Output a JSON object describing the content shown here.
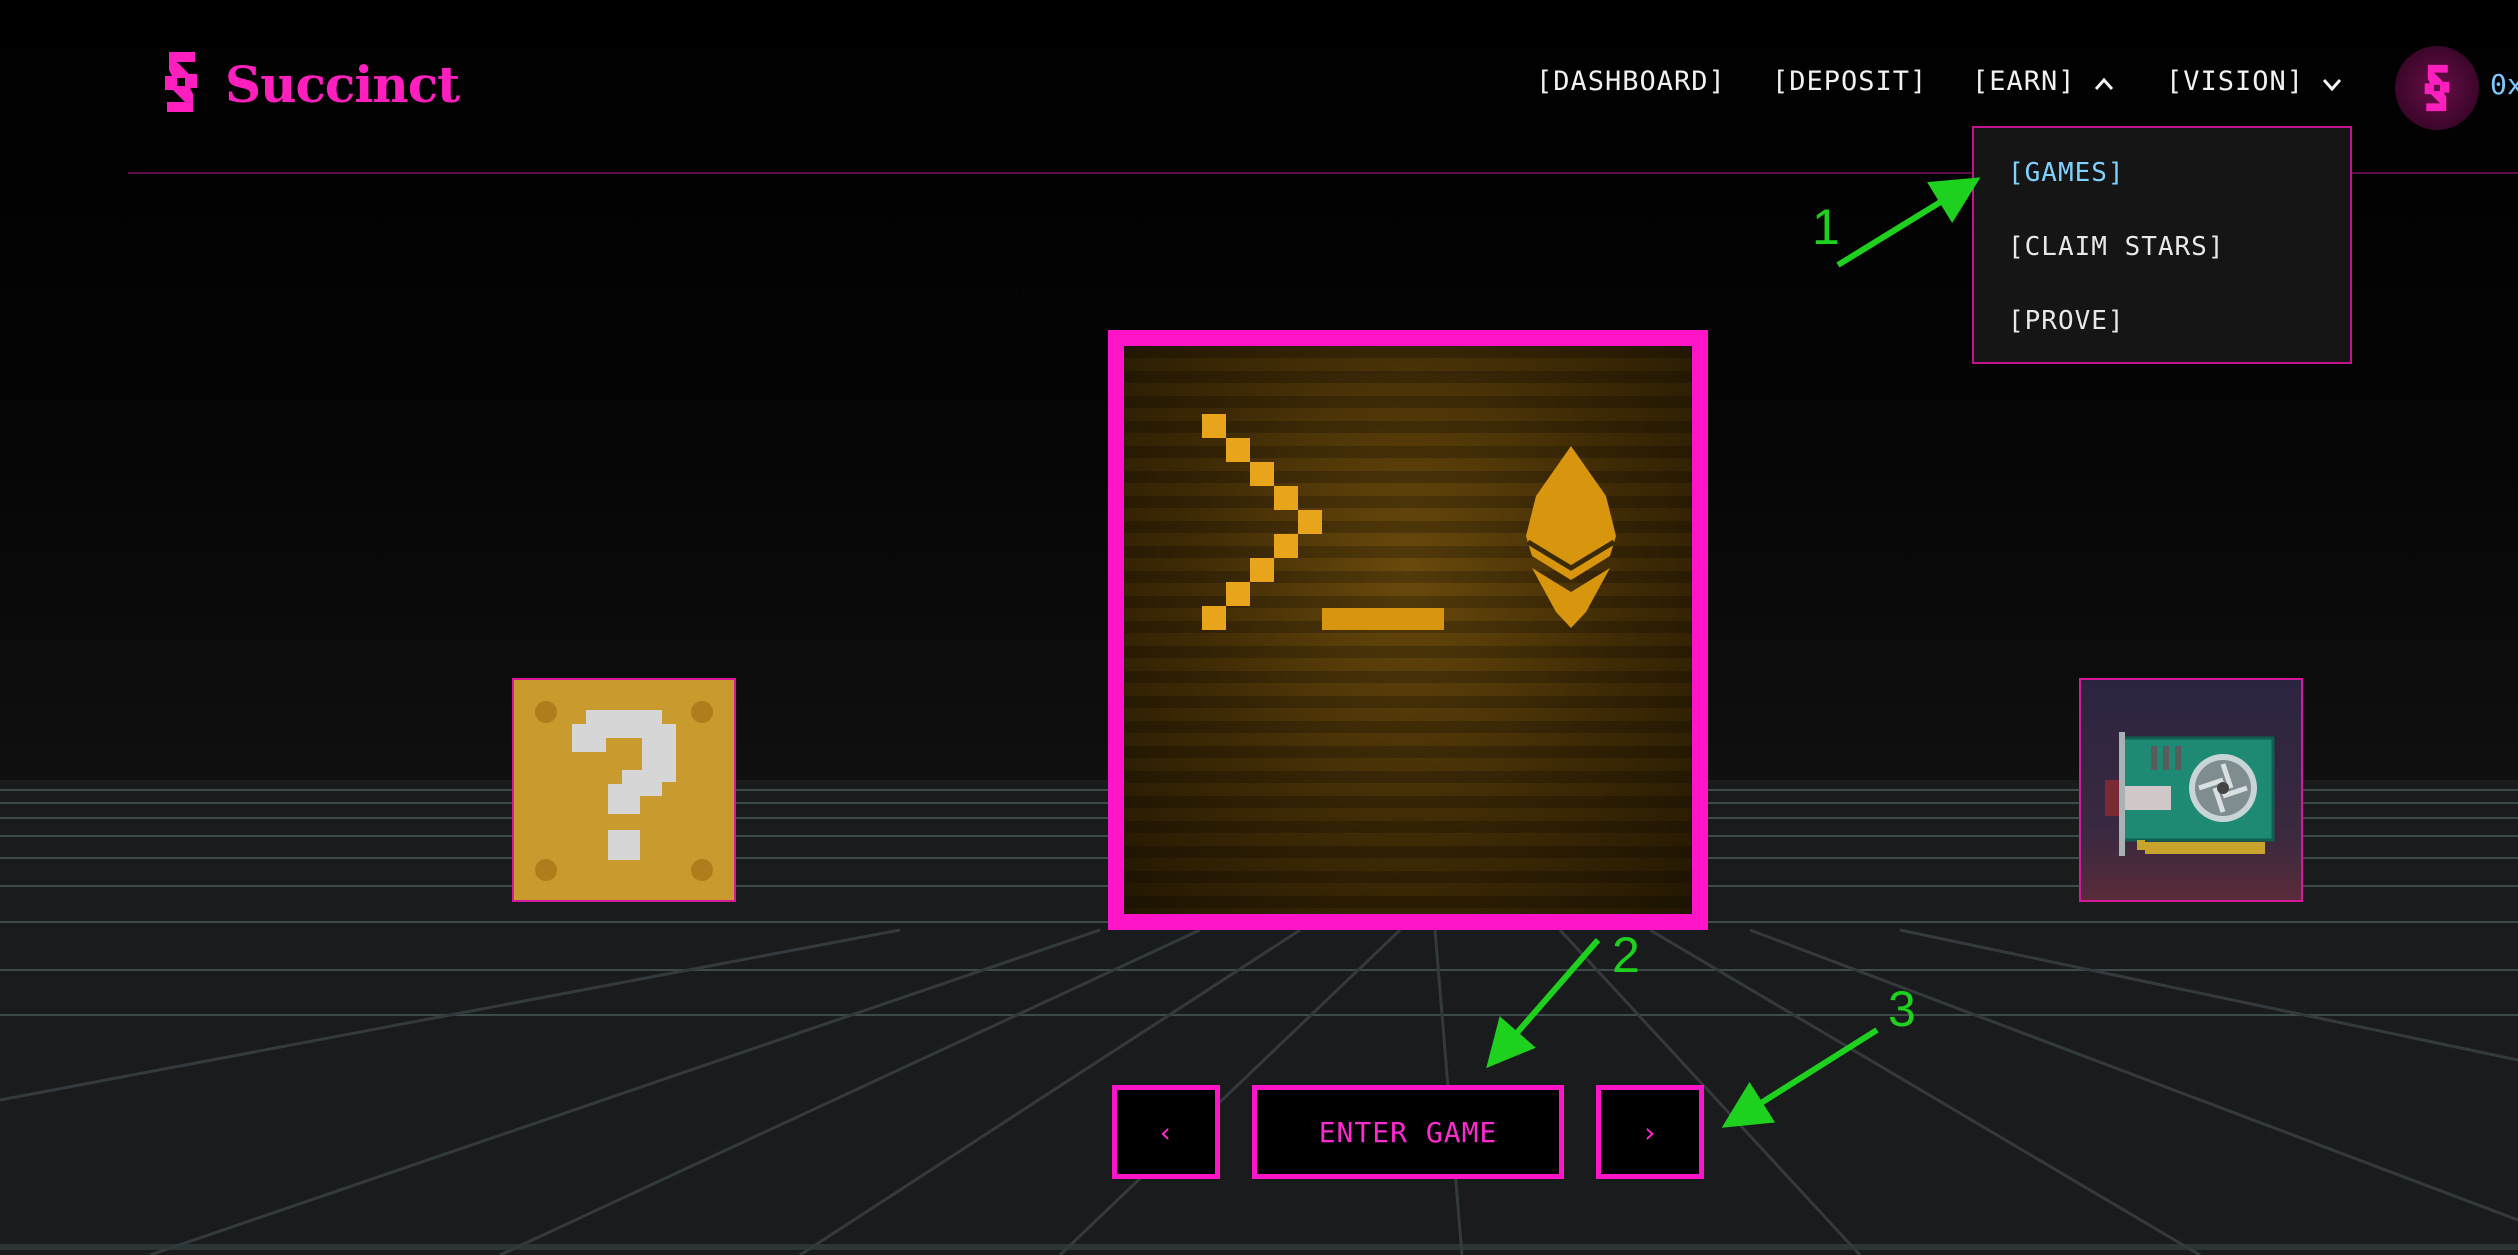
{
  "brand": {
    "name": "Succinct",
    "color": "#ff1fbf"
  },
  "nav": {
    "items": [
      {
        "label": "[DASHBOARD]"
      },
      {
        "label": "[DEPOSIT]"
      },
      {
        "label": "[EARN]",
        "expanded": true
      },
      {
        "label": "[VISION]",
        "expanded": false
      }
    ]
  },
  "account": {
    "address": "0x",
    "avatar_icon": "succinct-logo-icon"
  },
  "dropdown": {
    "items": [
      {
        "label": "[GAMES]",
        "active": true
      },
      {
        "label": "[CLAIM STARS]"
      },
      {
        "label": "[PROVE]"
      }
    ]
  },
  "carousel": {
    "cards": [
      {
        "icon": "question-block-icon"
      },
      {
        "icon": "terminal-ethereum-icon",
        "selected": true
      },
      {
        "icon": "gpu-card-icon"
      }
    ],
    "prev_label": "‹",
    "enter_label": "ENTER GAME",
    "next_label": "›"
  },
  "annotations": [
    {
      "label": "1"
    },
    {
      "label": "2"
    },
    {
      "label": "3"
    }
  ],
  "colors": {
    "accent": "#ff14c8",
    "active_link": "#7fd2ff",
    "annotation": "#1fd11f"
  }
}
